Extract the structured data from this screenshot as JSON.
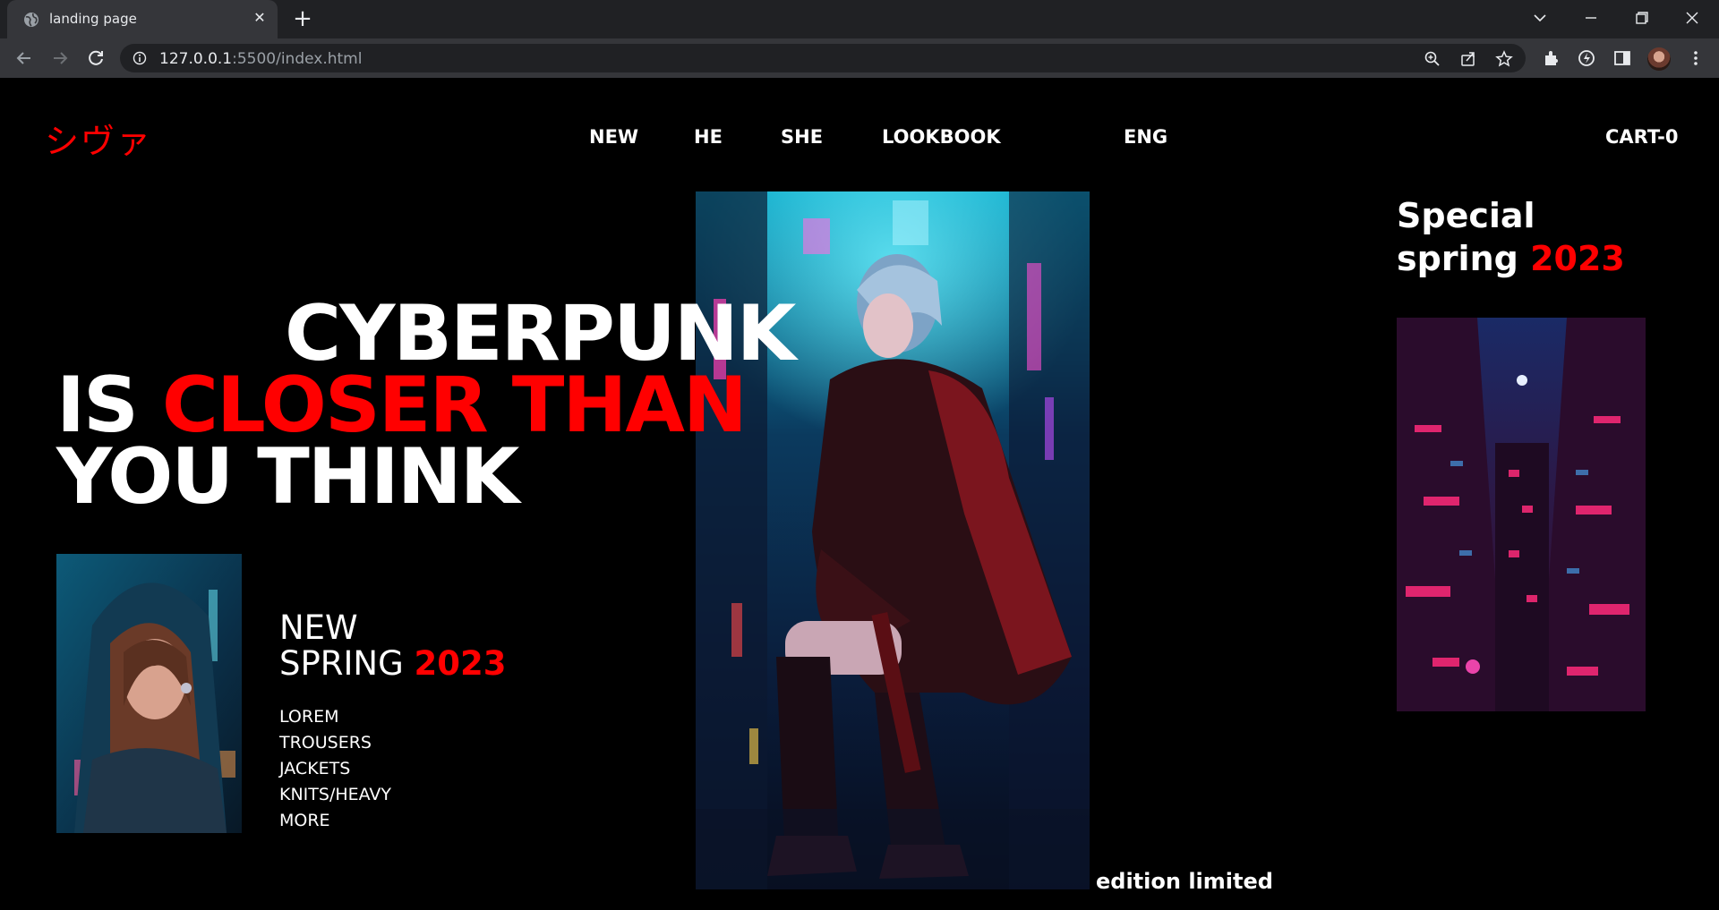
{
  "browser": {
    "tab_title": "landing page",
    "url_host": "127.0.0.1",
    "url_rest": ":5500/index.html"
  },
  "site": {
    "logo": "シヴァ",
    "nav": [
      "NEW",
      "HE",
      "SHE",
      "LOOKBOOK",
      "ENG"
    ],
    "cart": "CART-0"
  },
  "hero": {
    "line1": "CYBERPUNK",
    "line2_white": "IS ",
    "line2_red": "CLOSER THAN",
    "line3": "YOU THINK"
  },
  "collection": {
    "line1": "NEW",
    "line2": "SPRING ",
    "year": "2023",
    "categories": [
      "LOREM",
      "TROUSERS",
      "JACKETS",
      "KNITS/HEAVY",
      "MORE"
    ]
  },
  "special": {
    "line1": "Special",
    "line2": "spring ",
    "year": "2023"
  },
  "edition": "edition limited",
  "colors": {
    "accent": "#ff0000",
    "background": "#000000"
  }
}
